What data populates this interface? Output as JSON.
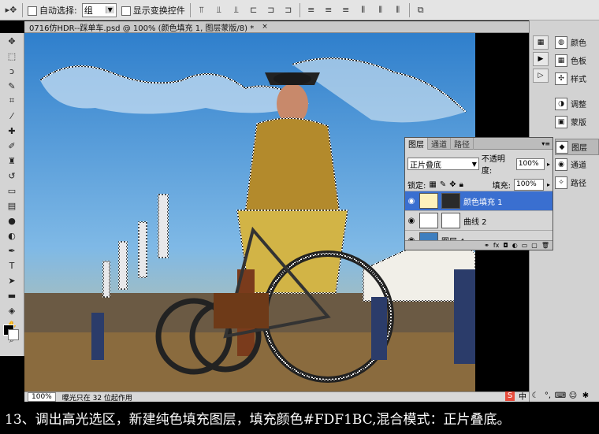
{
  "options_bar": {
    "auto_select_label": "自动选择:",
    "auto_select_value": "组",
    "show_transform_label": "显示变换控件"
  },
  "document": {
    "tab_title": "0716仿HDR--踩单车.psd @ 100% (颜色填充 1, 图层蒙版/8) *",
    "close_glyph": "×",
    "zoom": "100%",
    "status_text": "曝光只在 32 位起作用"
  },
  "dock": {
    "buttons": [
      {
        "label": "颜色",
        "icon": "color-icon"
      },
      {
        "label": "色板",
        "icon": "swatches-icon"
      },
      {
        "label": "样式",
        "icon": "styles-icon"
      },
      {
        "label": "调整",
        "icon": "adjustments-icon"
      },
      {
        "label": "蒙版",
        "icon": "masks-icon"
      },
      {
        "label": "图层",
        "icon": "layers-icon"
      },
      {
        "label": "通道",
        "icon": "channels-icon"
      },
      {
        "label": "路径",
        "icon": "paths-icon"
      }
    ]
  },
  "layers_panel": {
    "tabs": [
      "图层",
      "通道",
      "路径"
    ],
    "blend_mode": "正片叠底",
    "opacity_label": "不透明度:",
    "opacity_value": "100%",
    "lock_label": "锁定:",
    "fill_label": "填充:",
    "fill_value": "100%",
    "layers": [
      {
        "name": "颜色填充 1",
        "selected": true,
        "thumb_color": "#FDF1BC"
      },
      {
        "name": "曲线 2",
        "selected": false,
        "thumb_color": "#ffffff"
      },
      {
        "name": "图层 4",
        "selected": false,
        "thumb_color": "#3f7fbf"
      }
    ]
  },
  "caption": {
    "text": "13、调出高光选区，新建纯色填充图层，填充颜色#FDF1BC,混合模式：正片叠底。"
  },
  "colors": {
    "fill_color": "#FDF1BC",
    "selection_highlight": "#3a6fd0"
  }
}
